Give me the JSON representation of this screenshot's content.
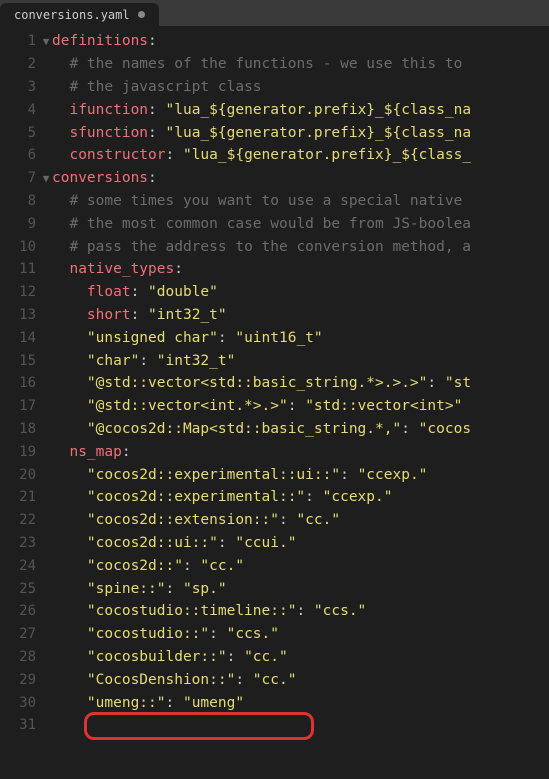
{
  "tab": {
    "filename": "conversions.yaml"
  },
  "lines": [
    {
      "n": 1,
      "fold": "▼",
      "segs": [
        {
          "t": "key",
          "v": "definitions"
        },
        {
          "t": "pun",
          "v": ":"
        }
      ]
    },
    {
      "n": 2,
      "fold": "",
      "segs": [
        {
          "t": "pun",
          "v": "  "
        },
        {
          "t": "com",
          "v": "# the names of the functions - we use this to "
        }
      ]
    },
    {
      "n": 3,
      "fold": "",
      "segs": [
        {
          "t": "pun",
          "v": "  "
        },
        {
          "t": "com",
          "v": "# the javascript class"
        }
      ]
    },
    {
      "n": 4,
      "fold": "",
      "segs": [
        {
          "t": "pun",
          "v": "  "
        },
        {
          "t": "key",
          "v": "ifunction"
        },
        {
          "t": "pun",
          "v": ": "
        },
        {
          "t": "str",
          "v": "\"lua_${generator.prefix}_${class_na"
        }
      ]
    },
    {
      "n": 5,
      "fold": "",
      "segs": [
        {
          "t": "pun",
          "v": "  "
        },
        {
          "t": "key",
          "v": "sfunction"
        },
        {
          "t": "pun",
          "v": ": "
        },
        {
          "t": "str",
          "v": "\"lua_${generator.prefix}_${class_na"
        }
      ]
    },
    {
      "n": 6,
      "fold": "",
      "segs": [
        {
          "t": "pun",
          "v": "  "
        },
        {
          "t": "key",
          "v": "constructor"
        },
        {
          "t": "pun",
          "v": ": "
        },
        {
          "t": "str",
          "v": "\"lua_${generator.prefix}_${class_"
        }
      ]
    },
    {
      "n": 7,
      "fold": "▼",
      "segs": [
        {
          "t": "key",
          "v": "conversions"
        },
        {
          "t": "pun",
          "v": ":"
        }
      ]
    },
    {
      "n": 8,
      "fold": "",
      "segs": [
        {
          "t": "pun",
          "v": "  "
        },
        {
          "t": "com",
          "v": "# some times you want to use a special native "
        }
      ]
    },
    {
      "n": 9,
      "fold": "",
      "segs": [
        {
          "t": "pun",
          "v": "  "
        },
        {
          "t": "com",
          "v": "# the most common case would be from JS-boolea"
        }
      ]
    },
    {
      "n": 10,
      "fold": "",
      "segs": [
        {
          "t": "pun",
          "v": "  "
        },
        {
          "t": "com",
          "v": "# pass the address to the conversion method, a"
        }
      ]
    },
    {
      "n": 11,
      "fold": "",
      "segs": [
        {
          "t": "pun",
          "v": "  "
        },
        {
          "t": "key",
          "v": "native_types"
        },
        {
          "t": "pun",
          "v": ":"
        }
      ]
    },
    {
      "n": 12,
      "fold": "",
      "segs": [
        {
          "t": "pun",
          "v": "    "
        },
        {
          "t": "key",
          "v": "float"
        },
        {
          "t": "pun",
          "v": ": "
        },
        {
          "t": "str",
          "v": "\"double\""
        }
      ]
    },
    {
      "n": 13,
      "fold": "",
      "segs": [
        {
          "t": "pun",
          "v": "    "
        },
        {
          "t": "key",
          "v": "short"
        },
        {
          "t": "pun",
          "v": ": "
        },
        {
          "t": "str",
          "v": "\"int32_t\""
        }
      ]
    },
    {
      "n": 14,
      "fold": "",
      "segs": [
        {
          "t": "pun",
          "v": "    "
        },
        {
          "t": "str",
          "v": "\"unsigned char\""
        },
        {
          "t": "pun",
          "v": ": "
        },
        {
          "t": "str",
          "v": "\"uint16_t\""
        }
      ]
    },
    {
      "n": 15,
      "fold": "",
      "segs": [
        {
          "t": "pun",
          "v": "    "
        },
        {
          "t": "str",
          "v": "\"char\""
        },
        {
          "t": "pun",
          "v": ": "
        },
        {
          "t": "str",
          "v": "\"int32_t\""
        }
      ]
    },
    {
      "n": 16,
      "fold": "",
      "segs": [
        {
          "t": "pun",
          "v": "    "
        },
        {
          "t": "str",
          "v": "\"@std::vector<std::basic_string.*>.>.>\""
        },
        {
          "t": "pun",
          "v": ": "
        },
        {
          "t": "str",
          "v": "\"st"
        }
      ]
    },
    {
      "n": 17,
      "fold": "",
      "segs": [
        {
          "t": "pun",
          "v": "    "
        },
        {
          "t": "str",
          "v": "\"@std::vector<int.*>.>\""
        },
        {
          "t": "pun",
          "v": ": "
        },
        {
          "t": "str",
          "v": "\"std::vector<int>\""
        }
      ]
    },
    {
      "n": 18,
      "fold": "",
      "segs": [
        {
          "t": "pun",
          "v": "    "
        },
        {
          "t": "str",
          "v": "\"@cocos2d::Map<std::basic_string.*,\""
        },
        {
          "t": "pun",
          "v": ": "
        },
        {
          "t": "str",
          "v": "\"cocos"
        }
      ]
    },
    {
      "n": 19,
      "fold": "",
      "segs": [
        {
          "t": "pun",
          "v": "  "
        },
        {
          "t": "key",
          "v": "ns_map"
        },
        {
          "t": "pun",
          "v": ":"
        }
      ]
    },
    {
      "n": 20,
      "fold": "",
      "segs": [
        {
          "t": "pun",
          "v": "    "
        },
        {
          "t": "str",
          "v": "\"cocos2d::experimental::ui::\""
        },
        {
          "t": "pun",
          "v": ": "
        },
        {
          "t": "str",
          "v": "\"ccexp.\""
        }
      ]
    },
    {
      "n": 21,
      "fold": "",
      "segs": [
        {
          "t": "pun",
          "v": "    "
        },
        {
          "t": "str",
          "v": "\"cocos2d::experimental::\""
        },
        {
          "t": "pun",
          "v": ": "
        },
        {
          "t": "str",
          "v": "\"ccexp.\""
        }
      ]
    },
    {
      "n": 22,
      "fold": "",
      "segs": [
        {
          "t": "pun",
          "v": "    "
        },
        {
          "t": "str",
          "v": "\"cocos2d::extension::\""
        },
        {
          "t": "pun",
          "v": ": "
        },
        {
          "t": "str",
          "v": "\"cc.\""
        }
      ]
    },
    {
      "n": 23,
      "fold": "",
      "segs": [
        {
          "t": "pun",
          "v": "    "
        },
        {
          "t": "str",
          "v": "\"cocos2d::ui::\""
        },
        {
          "t": "pun",
          "v": ": "
        },
        {
          "t": "str",
          "v": "\"ccui.\""
        }
      ]
    },
    {
      "n": 24,
      "fold": "",
      "segs": [
        {
          "t": "pun",
          "v": "    "
        },
        {
          "t": "str",
          "v": "\"cocos2d::\""
        },
        {
          "t": "pun",
          "v": ": "
        },
        {
          "t": "str",
          "v": "\"cc.\""
        }
      ]
    },
    {
      "n": 25,
      "fold": "",
      "segs": [
        {
          "t": "pun",
          "v": "    "
        },
        {
          "t": "str",
          "v": "\"spine::\""
        },
        {
          "t": "pun",
          "v": ": "
        },
        {
          "t": "str",
          "v": "\"sp.\""
        }
      ]
    },
    {
      "n": 26,
      "fold": "",
      "segs": [
        {
          "t": "pun",
          "v": "    "
        },
        {
          "t": "str",
          "v": "\"cocostudio::timeline::\""
        },
        {
          "t": "pun",
          "v": ": "
        },
        {
          "t": "str",
          "v": "\"ccs.\""
        }
      ]
    },
    {
      "n": 27,
      "fold": "",
      "segs": [
        {
          "t": "pun",
          "v": "    "
        },
        {
          "t": "str",
          "v": "\"cocostudio::\""
        },
        {
          "t": "pun",
          "v": ": "
        },
        {
          "t": "str",
          "v": "\"ccs.\""
        }
      ]
    },
    {
      "n": 28,
      "fold": "",
      "segs": [
        {
          "t": "pun",
          "v": "    "
        },
        {
          "t": "str",
          "v": "\"cocosbuilder::\""
        },
        {
          "t": "pun",
          "v": ": "
        },
        {
          "t": "str",
          "v": "\"cc.\""
        }
      ]
    },
    {
      "n": 29,
      "fold": "",
      "segs": [
        {
          "t": "pun",
          "v": "    "
        },
        {
          "t": "str",
          "v": "\"CocosDenshion::\""
        },
        {
          "t": "pun",
          "v": ": "
        },
        {
          "t": "str",
          "v": "\"cc.\""
        }
      ]
    },
    {
      "n": 30,
      "fold": "",
      "segs": [
        {
          "t": "pun",
          "v": "    "
        },
        {
          "t": "str",
          "v": "\"umeng::\""
        },
        {
          "t": "pun",
          "v": ": "
        },
        {
          "t": "str",
          "v": "\"umeng\""
        }
      ]
    },
    {
      "n": 31,
      "fold": "",
      "segs": []
    }
  ]
}
